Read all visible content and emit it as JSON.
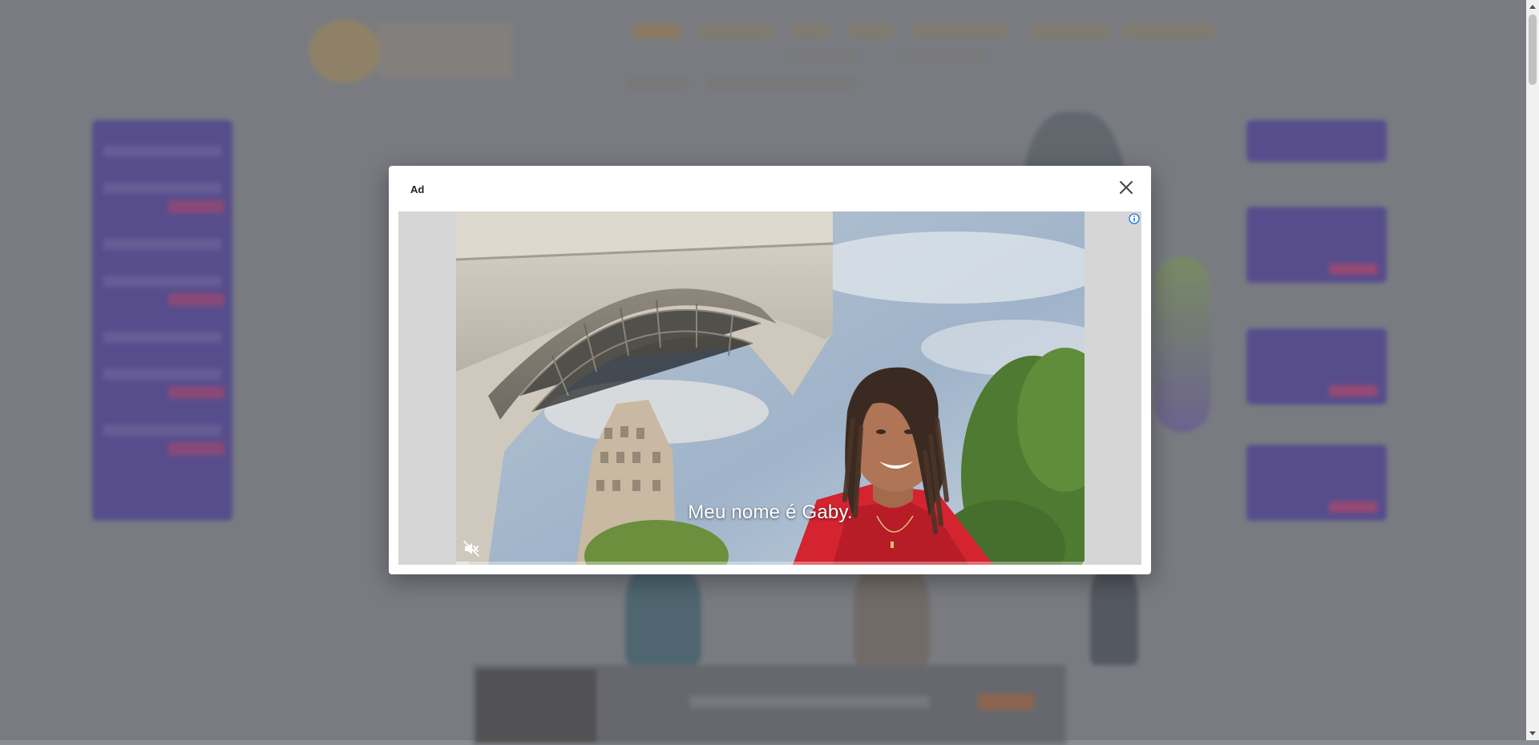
{
  "modal": {
    "title": "Ad",
    "close_icon": "close-icon",
    "info_icon": "info-icon"
  },
  "video": {
    "subtitle": "Meu nome é Gaby.",
    "mute_icon": "muted-speaker-icon",
    "progress": 0.02
  },
  "colors": {
    "overlay": "#8a8d93",
    "brand_purple": "#4e3aa6",
    "accent_pink": "#c0327a",
    "info_blue": "#1a73e8"
  },
  "scrollbar": {
    "up_icon": "scroll-up-arrow-icon",
    "down_icon": "scroll-down-arrow-icon"
  }
}
